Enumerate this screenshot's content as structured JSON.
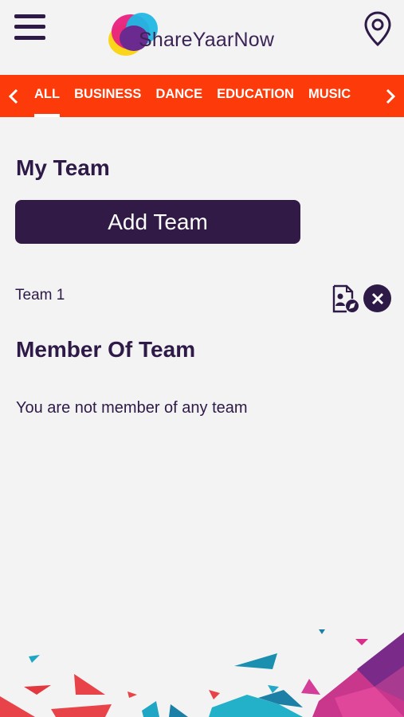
{
  "app": {
    "logo_text": "ShareYaarNow"
  },
  "categories": [
    {
      "label": "ALL",
      "active": true
    },
    {
      "label": "BUSINESS"
    },
    {
      "label": "DANCE"
    },
    {
      "label": "EDUCATION"
    },
    {
      "label": "MUSIC"
    }
  ],
  "my_team": {
    "title": "My Team",
    "add_label": "Add Team",
    "teams": [
      {
        "name": "Team 1"
      }
    ]
  },
  "member_of": {
    "title": "Member Of Team",
    "empty_message": "You are not member of any team"
  },
  "colors": {
    "accent_bar": "#fc3a0a",
    "primary": "#311a45",
    "background": "#f4f3f4"
  },
  "icons": {
    "menu": "hamburger-menu-icon",
    "location": "map-pin-icon",
    "prev": "chevron-left-icon",
    "next": "chevron-right-icon",
    "edit": "edit-document-icon",
    "delete": "close-circle-icon"
  }
}
